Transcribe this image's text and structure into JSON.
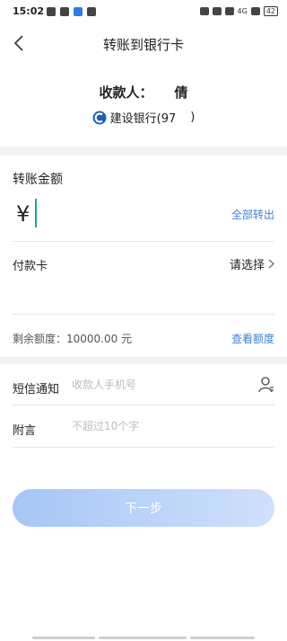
{
  "status_bar": {
    "time": "15:02",
    "right_text": "4G",
    "battery": "42"
  },
  "header": {
    "title": "转账到银行卡"
  },
  "payee": {
    "label": "收款人：",
    "name": "倩",
    "bank": "建设银行(97",
    "bank_suffix": ")"
  },
  "amount": {
    "section_title": "转账金额",
    "currency_symbol": "¥",
    "all_out_label": "全部转出"
  },
  "pay_card": {
    "label": "付款卡",
    "select_label": "请选择"
  },
  "limit": {
    "remaining_label": "剩余额度：10000.00  元",
    "check_label": "查看额度"
  },
  "sms": {
    "label": "短信通知",
    "placeholder": "收款人手机号"
  },
  "memo": {
    "label": "附言",
    "placeholder": "不超过10个字"
  },
  "actions": {
    "next_label": "下一步"
  },
  "colors": {
    "accent": "#3d7fd9",
    "cursor": "#1aa79c",
    "button_start": "#a6c6f6",
    "button_end": "#cfe0fb",
    "band": "#f3f3f3"
  }
}
